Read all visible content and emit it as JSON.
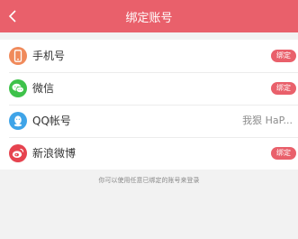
{
  "header": {
    "title": "绑定账号",
    "back_icon": "chevron-left-icon",
    "background": "#e9606b"
  },
  "accounts": [
    {
      "label": "手机号",
      "icon": "phone-icon",
      "icon_color": "#f08a5b",
      "action": "绑定"
    },
    {
      "label": "微信",
      "icon": "wechat-icon",
      "icon_color": "#3ec24a",
      "action": "绑定"
    },
    {
      "label": "QQ帐号",
      "icon": "qq-icon",
      "icon_color": "#3fa4e8",
      "bound_name": "我狠 HaP..."
    },
    {
      "label": "新浪微博",
      "icon": "weibo-icon",
      "icon_color": "#e6434f",
      "action": "绑定"
    }
  ],
  "footer": {
    "hint": "你可以使用任意已绑定的账号来登录"
  }
}
